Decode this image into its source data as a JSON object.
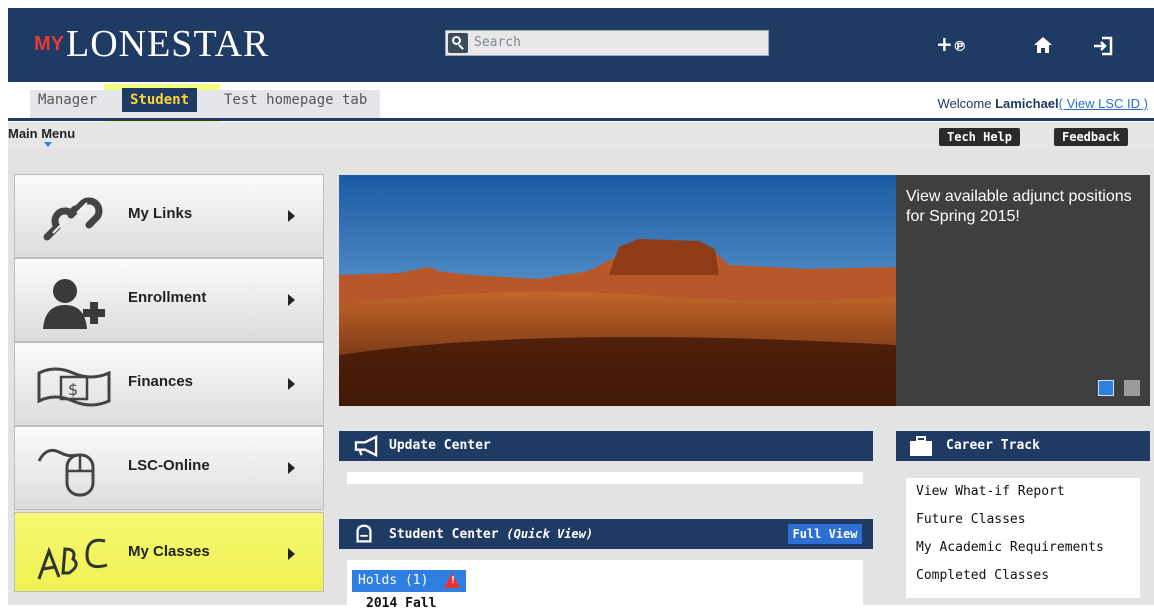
{
  "header": {
    "logo_prefix": "MY",
    "logo_text": "LONESTAR",
    "search_placeholder": "Search",
    "icons": [
      "add-link-icon",
      "home-icon",
      "signout-icon"
    ]
  },
  "tabs": [
    {
      "label": "Manager"
    },
    {
      "label": "Student",
      "active": true
    },
    {
      "label": "Test homepage tab"
    }
  ],
  "welcome": {
    "prefix": "Welcome ",
    "user": "Lamichael",
    "link": "( View LSC ID )"
  },
  "submenu": {
    "main_menu": "Main Menu",
    "tech_help": "Tech Help",
    "feedback": "Feedback"
  },
  "left_nav": [
    {
      "label": "My Links",
      "icon": "chain-link-icon"
    },
    {
      "label": "Enrollment",
      "icon": "add-user-icon"
    },
    {
      "label": "Finances",
      "icon": "dollar-bill-icon"
    },
    {
      "label": "LSC-Online",
      "icon": "mouse-icon"
    },
    {
      "label": "My Classes",
      "icon": "abc-icon",
      "highlighted": true
    }
  ],
  "promo": {
    "text": "View available adjunct positions for Spring 2015!"
  },
  "update_center": {
    "title": "Update Center"
  },
  "career_track": {
    "title": "Career Track",
    "links": [
      "View What-if Report",
      "Future Classes",
      "My Academic Requirements",
      "Completed Classes"
    ]
  },
  "student_center": {
    "title": "Student Center",
    "subtitle": "(Quick View)",
    "full_view": "Full View",
    "holds": "Holds (1)",
    "term": "2014 Fall"
  },
  "colors": {
    "brand_navy": "#1f3b63",
    "accent_yellow": "#ffd33a",
    "highlight": "#eef253",
    "link_blue": "#2e7fe0"
  }
}
